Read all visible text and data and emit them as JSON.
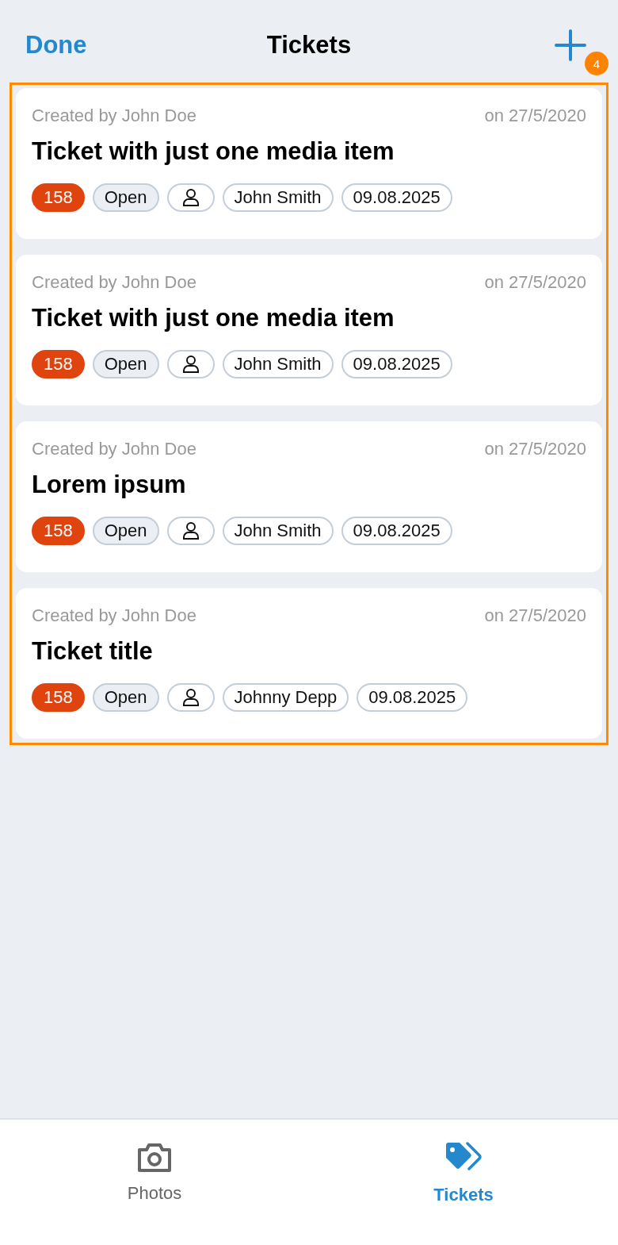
{
  "header": {
    "done": "Done",
    "title": "Tickets",
    "add_badge": "4"
  },
  "tickets": [
    {
      "creator": "Created by John Doe",
      "date": "on 27/5/2020",
      "title": "Ticket with just one media item",
      "number": "158",
      "status": "Open",
      "assignee": "John Smith",
      "due": "09.08.2025"
    },
    {
      "creator": "Created by John Doe",
      "date": "on 27/5/2020",
      "title": "Ticket with just one media item",
      "number": "158",
      "status": "Open",
      "assignee": "John Smith",
      "due": "09.08.2025"
    },
    {
      "creator": "Created by John Doe",
      "date": "on 27/5/2020",
      "title": "Lorem ipsum",
      "number": "158",
      "status": "Open",
      "assignee": "John Smith",
      "due": "09.08.2025"
    },
    {
      "creator": "Created by John Doe",
      "date": "on 27/5/2020",
      "title": "Ticket title",
      "number": "158",
      "status": "Open",
      "assignee": "Johnny Depp",
      "due": "09.08.2025"
    }
  ],
  "tabs": [
    {
      "label": "Photos",
      "kind": "camera",
      "selected": false
    },
    {
      "label": "Tickets",
      "kind": "tags",
      "selected": true
    }
  ]
}
